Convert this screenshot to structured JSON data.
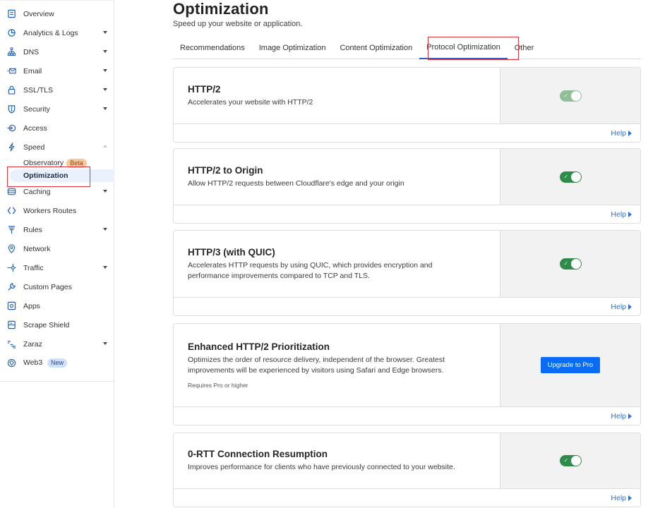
{
  "sidebar": {
    "items": [
      {
        "label": "Overview",
        "icon": "overview-icon",
        "caret": false
      },
      {
        "label": "Analytics & Logs",
        "icon": "analytics-icon",
        "caret": true
      },
      {
        "label": "DNS",
        "icon": "dns-icon",
        "caret": true
      },
      {
        "label": "Email",
        "icon": "email-icon",
        "caret": true
      },
      {
        "label": "SSL/TLS",
        "icon": "lock-icon",
        "caret": true
      },
      {
        "label": "Security",
        "icon": "shield-icon",
        "caret": true
      },
      {
        "label": "Access",
        "icon": "access-icon",
        "caret": false
      },
      {
        "label": "Speed",
        "icon": "lightning-icon",
        "caret": true,
        "expanded": true
      }
    ],
    "speed_children": [
      {
        "label": "Observatory",
        "badge": "Beta"
      },
      {
        "label": "Optimization",
        "active": true
      }
    ],
    "items_after": [
      {
        "label": "Caching",
        "icon": "caching-icon",
        "caret": true
      },
      {
        "label": "Workers Routes",
        "icon": "workers-icon",
        "caret": false
      },
      {
        "label": "Rules",
        "icon": "rules-icon",
        "caret": true
      },
      {
        "label": "Network",
        "icon": "network-icon",
        "caret": false
      },
      {
        "label": "Traffic",
        "icon": "traffic-icon",
        "caret": true
      },
      {
        "label": "Custom Pages",
        "icon": "wrench-icon",
        "caret": false
      },
      {
        "label": "Apps",
        "icon": "apps-icon",
        "caret": false
      },
      {
        "label": "Scrape Shield",
        "icon": "scrape-shield-icon",
        "caret": false
      },
      {
        "label": "Zaraz",
        "icon": "zaraz-icon",
        "caret": true
      },
      {
        "label": "Web3",
        "icon": "web3-icon",
        "caret": false,
        "badge": "New"
      }
    ]
  },
  "header": {
    "title": "Optimization",
    "subtitle": "Speed up your website or application."
  },
  "tabs": [
    {
      "label": "Recommendations",
      "active": false
    },
    {
      "label": "Image Optimization",
      "active": false
    },
    {
      "label": "Content Optimization",
      "active": false
    },
    {
      "label": "Protocol Optimization",
      "active": true
    },
    {
      "label": "Other",
      "active": false
    }
  ],
  "cards": [
    {
      "title": "HTTP/2",
      "description": "Accelerates your website with HTTP/2",
      "control": "toggle",
      "enabled": true,
      "disabled": true,
      "help": "Help"
    },
    {
      "title": "HTTP/2 to Origin",
      "description": "Allow HTTP/2 requests between Cloudflare's edge and your origin",
      "control": "toggle",
      "enabled": true,
      "disabled": false,
      "help": "Help"
    },
    {
      "title": "HTTP/3 (with QUIC)",
      "description": "Accelerates HTTP requests by using QUIC, which provides encryption and performance improvements compared to TCP and TLS.",
      "control": "toggle",
      "enabled": true,
      "disabled": false,
      "help": "Help"
    },
    {
      "title": "Enhanced HTTP/2 Prioritization",
      "description": "Optimizes the order of resource delivery, independent of the browser. Greatest improvements will be experienced by visitors using Safari and Edge browsers.",
      "note": "Requires Pro or higher",
      "control": "button",
      "button_label": "Upgrade to Pro",
      "help": "Help"
    },
    {
      "title": "0-RTT Connection Resumption",
      "description": "Improves performance for clients who have previously connected to your website.",
      "control": "toggle",
      "enabled": true,
      "disabled": false,
      "help": "Help"
    }
  ],
  "colors": {
    "accent": "#2f6fd6",
    "toggle_on": "#2e8b4a",
    "toggle_disabled": "#8fbe98",
    "upgrade_button": "#0a6cf5",
    "annotation": "#e0303a"
  }
}
